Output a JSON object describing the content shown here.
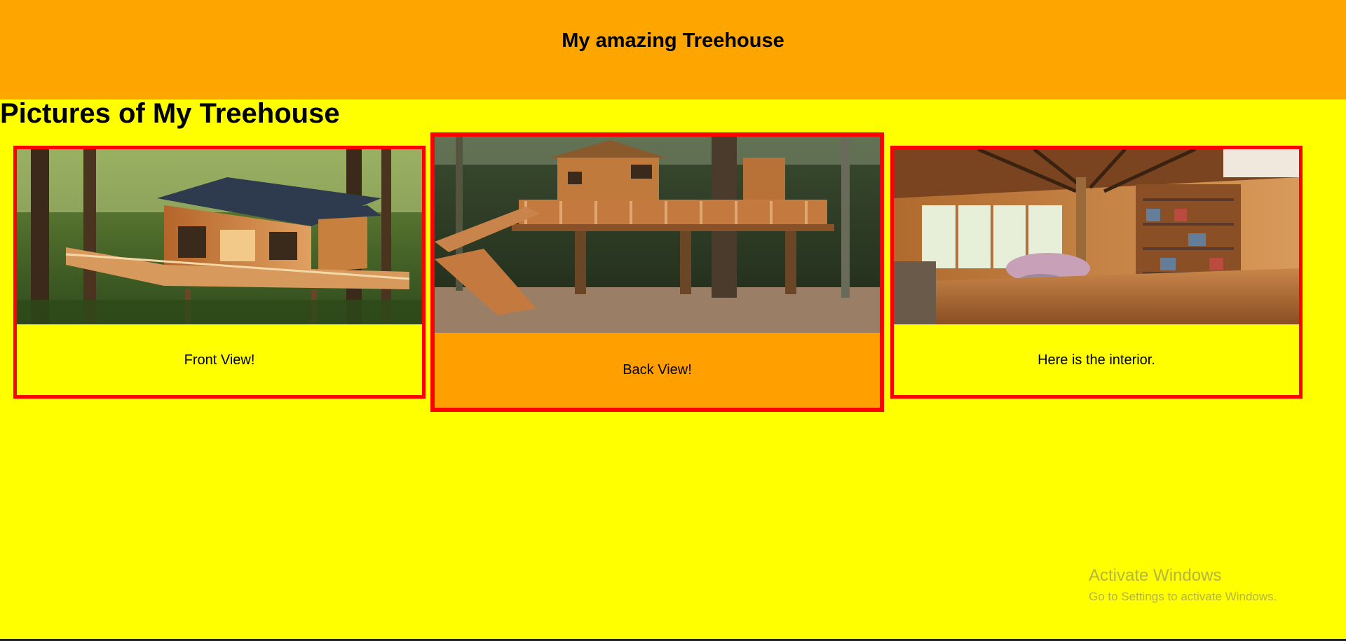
{
  "header": {
    "title": "My amazing Treehouse",
    "background": "#ffa500"
  },
  "main": {
    "heading": "Pictures of My Treehouse",
    "background": "#ffff00",
    "cards": [
      {
        "caption": "Front View!",
        "image": "treehouse-front-photo",
        "border_color": "#ff0000"
      },
      {
        "caption": "Back View!",
        "image": "treehouse-back-photo",
        "border_color": "#ff0000",
        "background": "#ff9f00"
      },
      {
        "caption": "Here is the interior.",
        "image": "treehouse-interior-photo",
        "border_color": "#ff0000"
      }
    ]
  },
  "watermark": {
    "title": "Activate Windows",
    "subtitle": "Go to Settings to activate Windows."
  }
}
